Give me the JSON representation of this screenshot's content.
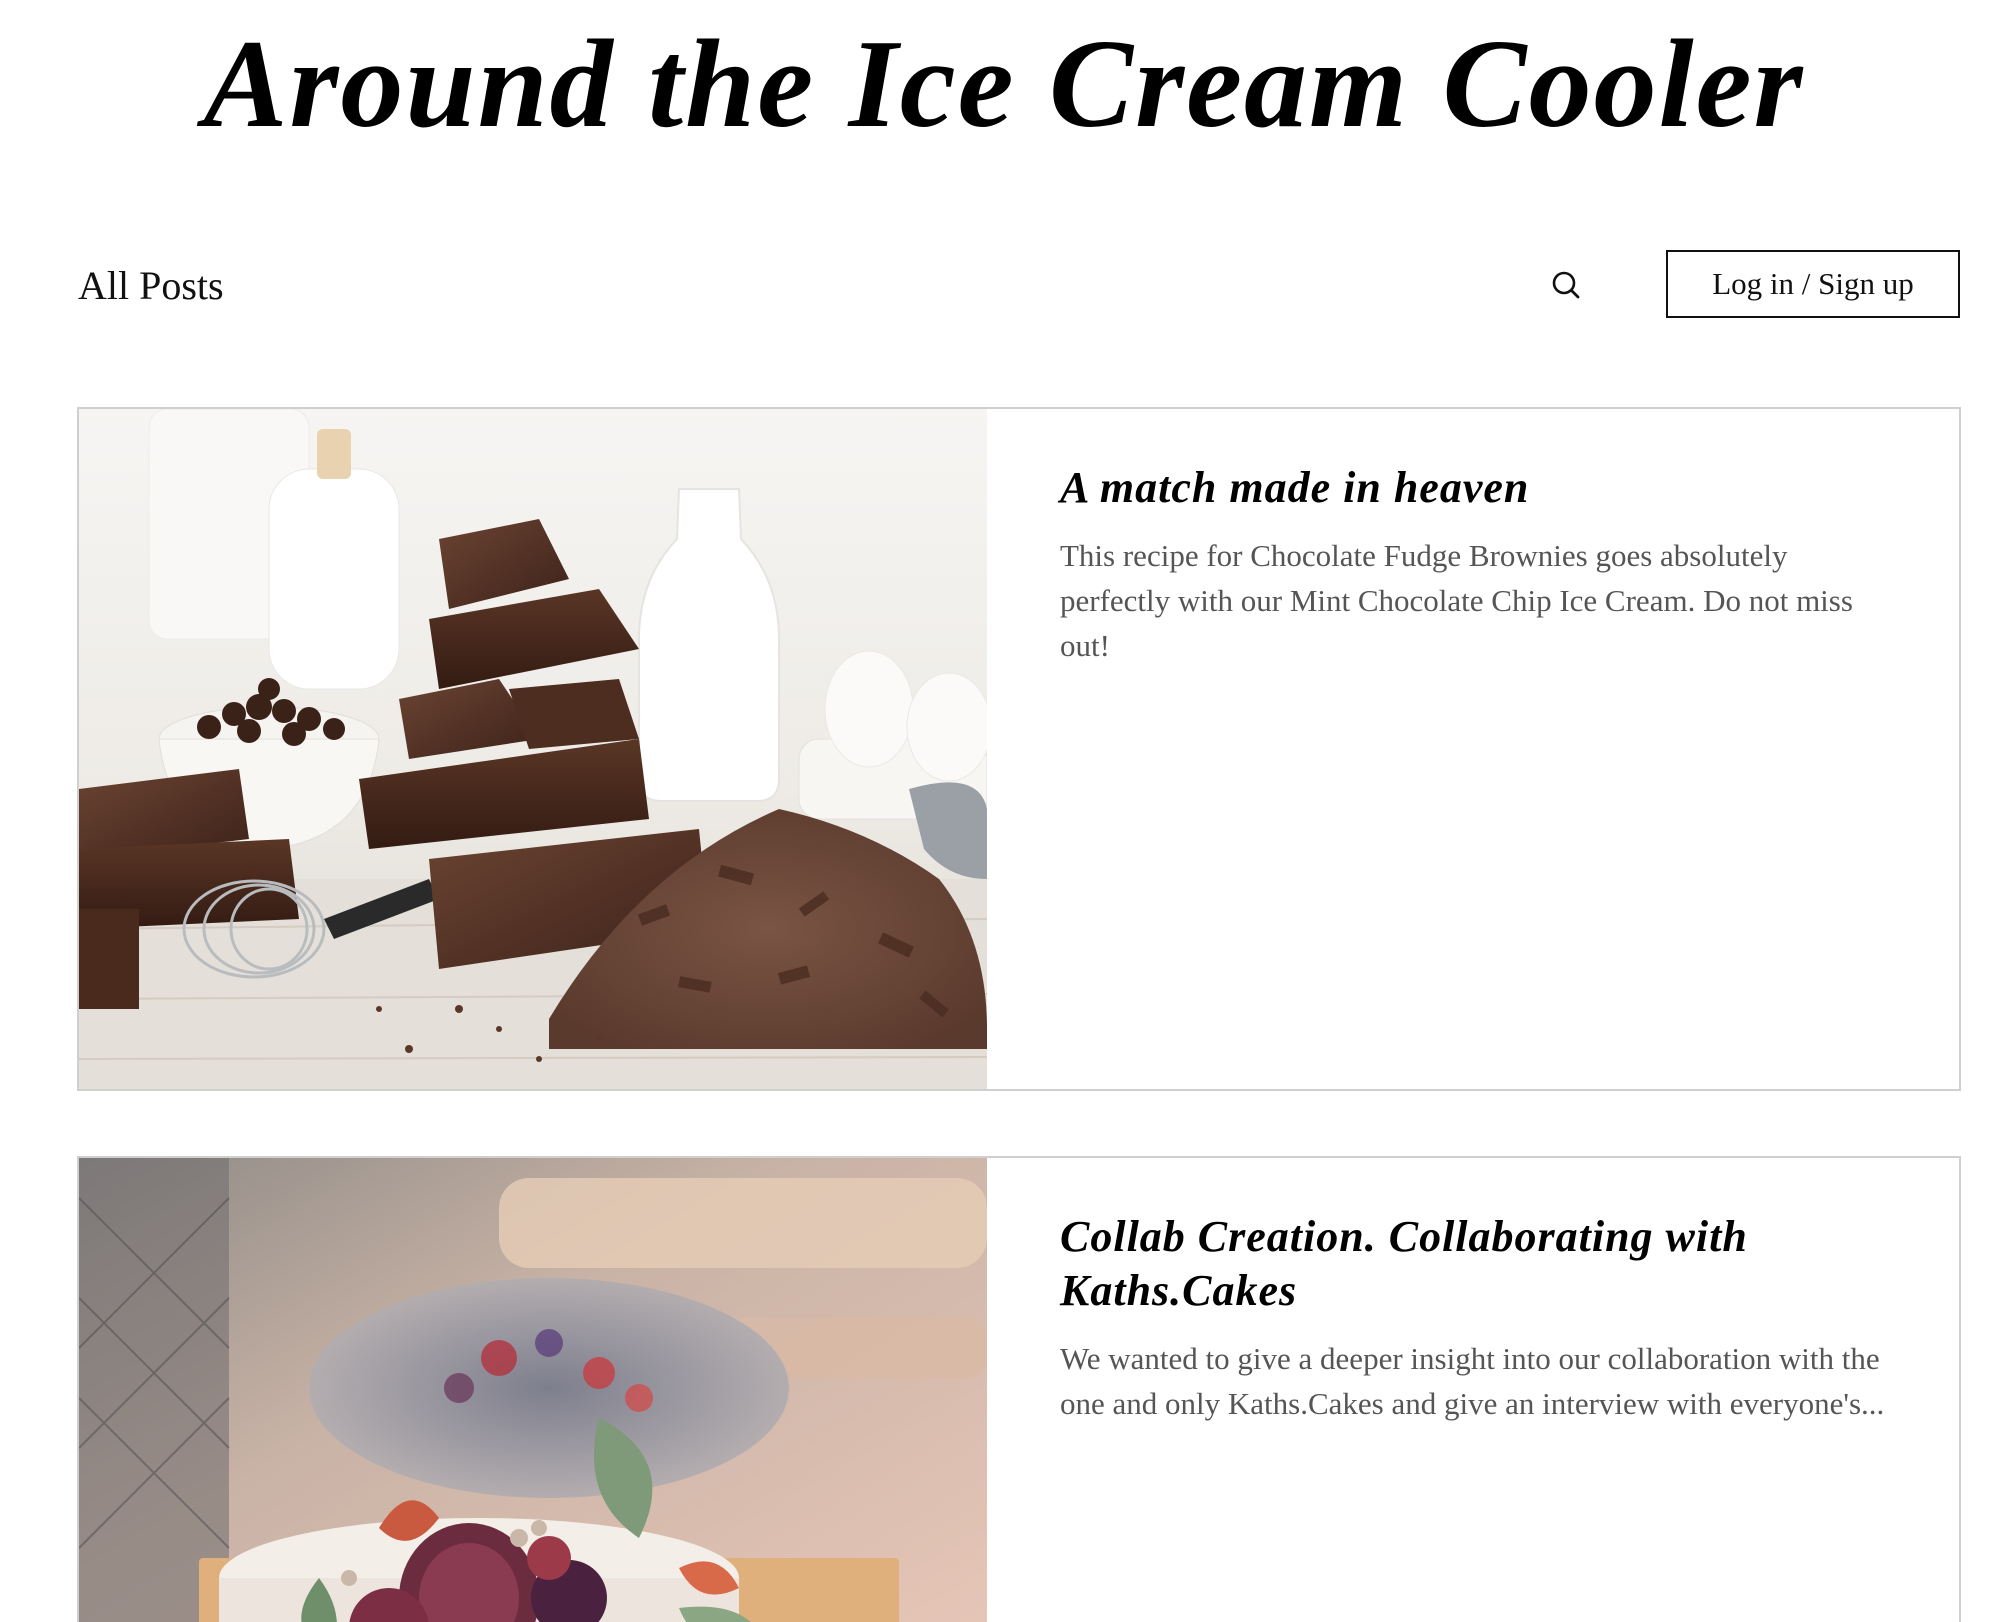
{
  "site": {
    "title": "Around the Ice Cream Cooler"
  },
  "nav": {
    "all_posts_label": "All Posts",
    "search_icon": "search-icon",
    "login_label": "Log in / Sign up"
  },
  "posts": [
    {
      "title": "A match made in heaven",
      "excerpt": "This recipe for Chocolate Fudge Brownies goes absolutely perfectly with our Mint Chocolate Chip Ice Cream. Do not miss out!",
      "image": "chocolate-baking-ingredients-photo"
    },
    {
      "title": "Collab Creation. Collaborating with Kaths.Cakes",
      "excerpt": "We wanted to give a deeper insight into our collaboration with the one and only Kaths.Cakes and give an interview with everyone's...",
      "image": "fig-decorated-cake-photo"
    }
  ],
  "colors": {
    "background": "#ffffff",
    "text": "#111111",
    "excerpt_text": "#555555",
    "card_border": "#cfcfcf"
  }
}
